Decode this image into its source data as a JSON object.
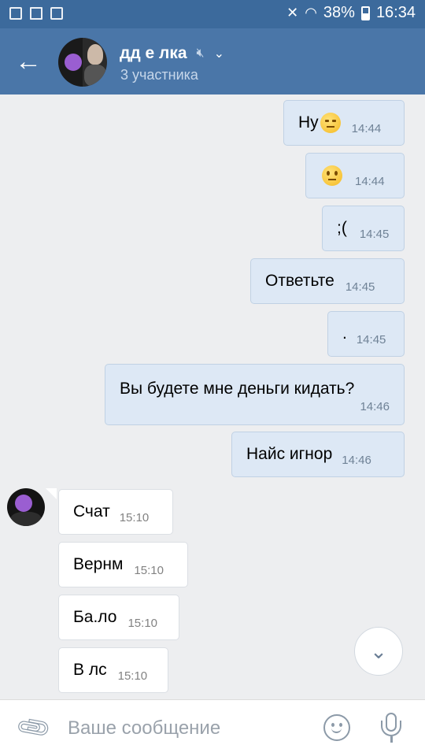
{
  "status_bar": {
    "battery": "38%",
    "time": "16:34",
    "left_icons": [
      "gallery-icon",
      "mail-icon",
      "recycle-icon"
    ],
    "right_icons": [
      "mute-icon",
      "wifi-icon",
      "battery-icon"
    ]
  },
  "header": {
    "back_icon": "arrow-left-icon",
    "title": "дд е лка",
    "subtitle": "3 участника",
    "muted_icon": "muted-speaker-icon",
    "dropdown_icon": "chevron-down-icon",
    "bg_color": "#4a76a8"
  },
  "messages": [
    {
      "direction": "out",
      "text": "Ну",
      "emoji": "expressionless-face",
      "time": "14:44"
    },
    {
      "direction": "out",
      "text": "",
      "emoji": "neutral-face",
      "time": "14:44"
    },
    {
      "direction": "out",
      "text": ";(",
      "time": "14:45"
    },
    {
      "direction": "out",
      "text": "Ответьте",
      "time": "14:45"
    },
    {
      "direction": "out",
      "text": ".",
      "time": "14:45"
    },
    {
      "direction": "out",
      "text": "Вы будете мне деньги кидать?",
      "time": "14:46"
    },
    {
      "direction": "out",
      "text": "Найс игнор",
      "time": "14:46"
    },
    {
      "direction": "in",
      "text": "Счат",
      "time": "15:10"
    },
    {
      "direction": "in",
      "text": "Вернм",
      "time": "15:10"
    },
    {
      "direction": "in",
      "text": "Ба.ло",
      "time": "15:10"
    },
    {
      "direction": "in",
      "text": "В лс",
      "time": "15:10"
    }
  ],
  "scroll_down_icon": "chevron-down-icon",
  "composer": {
    "attach_icon": "paperclip-icon",
    "placeholder": "Ваше сообщение",
    "emoji_icon": "smile-icon",
    "mic_icon": "microphone-icon"
  },
  "colors": {
    "outgoing_bubble": "#dde8f5",
    "incoming_bubble": "#ffffff",
    "chat_background": "#edeef0"
  }
}
